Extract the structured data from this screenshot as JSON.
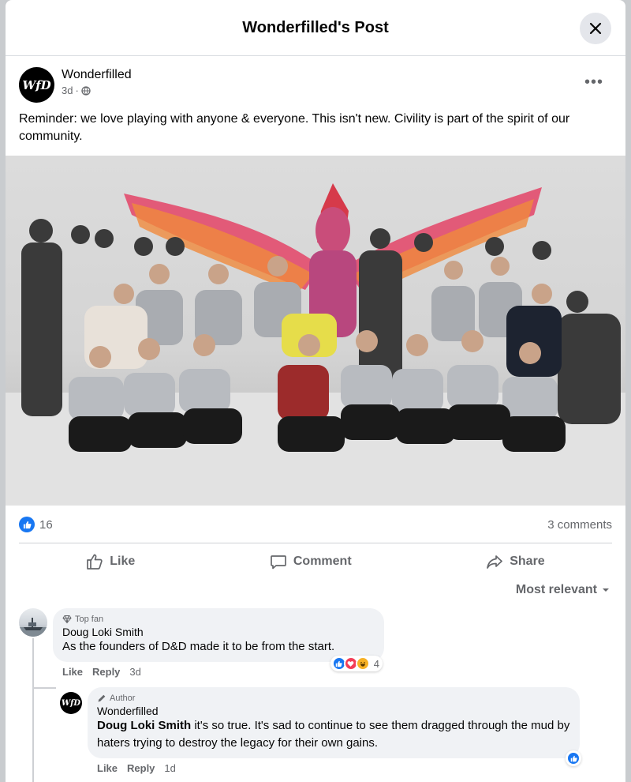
{
  "modal": {
    "title": "Wonderfilled's Post"
  },
  "post": {
    "author": "Wonderfilled",
    "avatar_text": "WfD",
    "time": "3d",
    "privacy_icon": "globe-icon",
    "more_label": "•••",
    "text": "Reminder: we love playing with anyone & everyone. This isn't new. Civility is part of the spirit of our community."
  },
  "stats": {
    "likes": "16",
    "comments": "3 comments"
  },
  "actions": {
    "like": "Like",
    "comment": "Comment",
    "share": "Share"
  },
  "sort": {
    "label": "Most relevant"
  },
  "comments": [
    {
      "badge": "Top fan",
      "name": "Doug Loki Smith",
      "text": "As the founders of D&D made it to be from the start.",
      "like": "Like",
      "reply": "Reply",
      "time": "3d",
      "reaction_count": "4",
      "reactions": [
        "like",
        "love",
        "haha"
      ]
    },
    {
      "badge": "Author",
      "name": "Wonderfilled",
      "avatar_text": "WfD",
      "mention": "Doug Loki Smith",
      "text": " it's so true. It's sad to continue to see them dragged through the mud by haters trying to destroy the legacy for their own gains.",
      "like": "Like",
      "reply": "Reply",
      "time": "1d",
      "reactions": [
        "like"
      ]
    }
  ],
  "colors": {
    "accent": "#1877f2",
    "love": "#f33e58",
    "haha": "#f7b125",
    "muted": "#65676b"
  }
}
